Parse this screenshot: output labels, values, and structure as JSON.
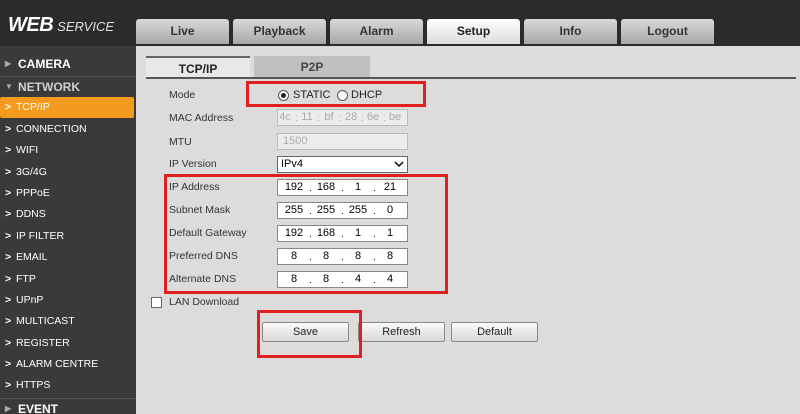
{
  "app": {
    "logo_main": "WEB",
    "logo_sub": "SERVICE"
  },
  "nav": {
    "tabs": [
      "Live",
      "Playback",
      "Alarm",
      "Setup",
      "Info",
      "Logout"
    ],
    "active": "Setup"
  },
  "sidebar": {
    "camera": "CAMERA",
    "network": "NETWORK",
    "items": [
      "TCP/IP",
      "CONNECTION",
      "WIFI",
      "3G/4G",
      "PPPoE",
      "DDNS",
      "IP FILTER",
      "EMAIL",
      "FTP",
      "UPnP",
      "MULTICAST",
      "REGISTER",
      "ALARM CENTRE",
      "HTTPS"
    ],
    "event": "EVENT",
    "active_item": "TCP/IP"
  },
  "subtabs": [
    "TCP/IP",
    "P2P"
  ],
  "form": {
    "mode_label": "Mode",
    "mode_static": "STATIC",
    "mode_dhcp": "DHCP",
    "mode_selected": "STATIC",
    "mac_label": "MAC Address",
    "mac": [
      "4c",
      "11",
      "bf",
      "28",
      "6e",
      "be"
    ],
    "mtu_label": "MTU",
    "mtu": "1500",
    "ipver_label": "IP Version",
    "ipver": "IPv4",
    "ip_label": "IP Address",
    "ip": [
      "192",
      "168",
      "1",
      "21"
    ],
    "mask_label": "Subnet Mask",
    "mask": [
      "255",
      "255",
      "255",
      "0"
    ],
    "gw_label": "Default Gateway",
    "gw": [
      "192",
      "168",
      "1",
      "1"
    ],
    "pdns_label": "Preferred DNS",
    "pdns": [
      "8",
      "8",
      "8",
      "8"
    ],
    "adns_label": "Alternate DNS",
    "adns": [
      "8",
      "8",
      "4",
      "4"
    ],
    "lan_download": "LAN Download"
  },
  "buttons": {
    "save": "Save",
    "refresh": "Refresh",
    "default": "Default"
  },
  "colors": {
    "accent": "#f39a1f",
    "highlight": "#e02020",
    "topbar": "#2b2b2b",
    "sidebar": "#3a3a3a"
  }
}
